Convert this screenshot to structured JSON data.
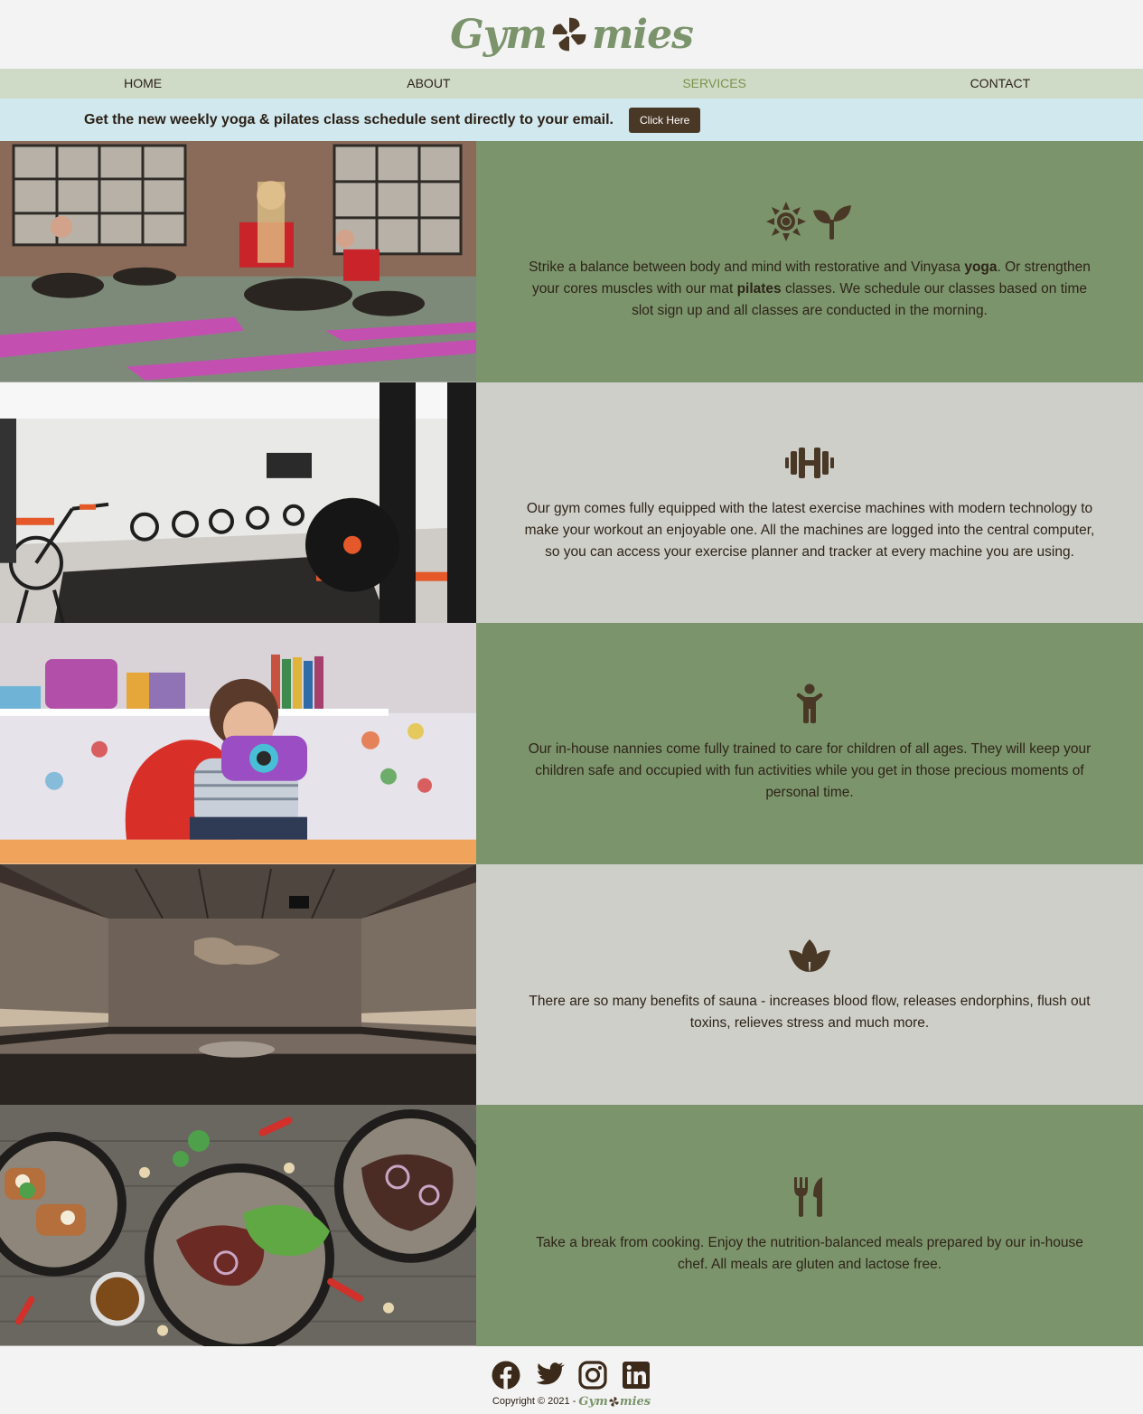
{
  "brand": {
    "logo_left": "Gym",
    "logo_right": "mies",
    "accent_color": "#7b946c",
    "dark_color": "#4a3826"
  },
  "nav": {
    "items": [
      {
        "label": "HOME"
      },
      {
        "label": "ABOUT"
      },
      {
        "label": "SERVICES"
      },
      {
        "label": "CONTACT"
      }
    ],
    "active": "SERVICES"
  },
  "banner": {
    "message": "Get the new weekly yoga & pilates class schedule sent directly to your email.",
    "button_label": "Click Here"
  },
  "services": [
    {
      "icons": [
        "sun-icon",
        "seedling-icon"
      ],
      "photo": "yoga-class-photo",
      "text_parts": [
        "Strike a balance between body and mind with restorative and Vinyasa ",
        "yoga",
        ". Or strengthen your cores muscles with our mat ",
        "pilates",
        " classes. We schedule our classes based on time slot sign up and all classes are conducted in the morning."
      ]
    },
    {
      "icons": [
        "dumbbell-icon"
      ],
      "photo": "gym-equipment-photo",
      "text": "Our gym comes fully equipped with the latest exercise machines with modern technology to make your workout an enjoyable one. All the machines are logged into the central computer, so you can access your exercise planner and tracker at every machine you are using."
    },
    {
      "icons": [
        "child-icon"
      ],
      "photo": "childcare-photo",
      "text": "Our in-house nannies come fully trained to care for children of all ages. They will keep your children safe and occupied with fun activities while you get in those precious moments of personal time."
    },
    {
      "icons": [
        "spa-lotus-icon"
      ],
      "photo": "sauna-photo",
      "text": "There are so many benefits of sauna - increases blood flow, releases endorphins, flush out toxins, relieves stress and much more."
    },
    {
      "icons": [
        "utensils-icon"
      ],
      "photo": "healthy-meals-photo",
      "text": "Take a break from cooking. Enjoy the nutrition-balanced meals prepared by our in-house chef. All meals are gluten and lactose free."
    }
  ],
  "footer": {
    "socials": [
      "facebook-icon",
      "twitter-icon",
      "instagram-icon",
      "linkedin-icon"
    ],
    "copyright": "Copyright © 2021 -",
    "logo_left": "Gym",
    "logo_right": "mies"
  }
}
